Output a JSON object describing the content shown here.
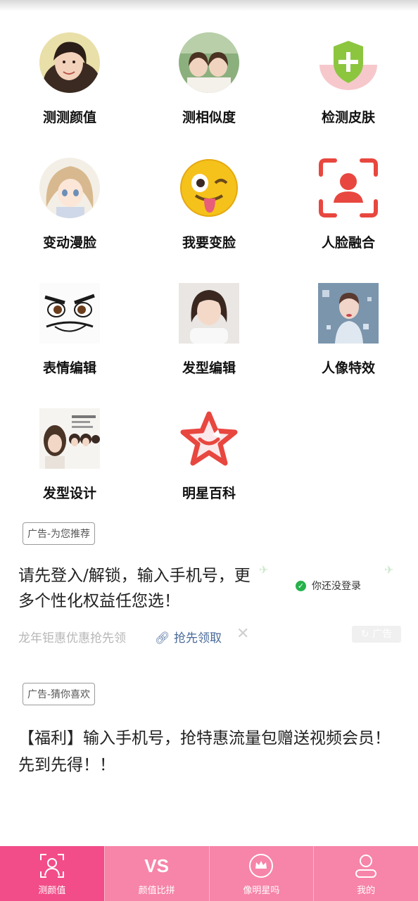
{
  "features": [
    {
      "label": "测测颜值",
      "icon": "woman-portrait-icon"
    },
    {
      "label": "测相似度",
      "icon": "two-girls-photo-icon"
    },
    {
      "label": "检测皮肤",
      "icon": "shield-plus-icon"
    },
    {
      "label": "变动漫脸",
      "icon": "anime-girl-icon"
    },
    {
      "label": "我要变脸",
      "icon": "winking-tongue-emoji-icon"
    },
    {
      "label": "人脸融合",
      "icon": "face-scan-icon"
    },
    {
      "label": "表情编辑",
      "icon": "cartoon-eyes-face-icon"
    },
    {
      "label": "发型编辑",
      "icon": "short-hair-girl-icon"
    },
    {
      "label": "人像特效",
      "icon": "dispersion-portrait-icon"
    },
    {
      "label": "发型设计",
      "icon": "hairstyle-catalog-icon"
    },
    {
      "label": "明星百科",
      "icon": "smiling-star-icon"
    }
  ],
  "ad1": {
    "tag": "广告-为您推荐",
    "text": "请先登入/解锁，输入手机号，更多个性化权益任您选！",
    "login_status": "你还没登录",
    "promo": "龙年钜惠优惠抢先领",
    "grab_label": "抢先领取",
    "badge": "广告"
  },
  "ad2": {
    "tag": "广告-猜你喜欢",
    "text": "【福利】输入手机号，抢特惠流量包赠送视频会员！先到先得！！"
  },
  "tabs": [
    {
      "label": "测颜值",
      "icon": "face-scan-person-icon",
      "active": true
    },
    {
      "label": "颜值比拼",
      "icon": "vs-icon",
      "icon_text": "VS"
    },
    {
      "label": "像明星吗",
      "icon": "crown-circle-icon"
    },
    {
      "label": "我的",
      "icon": "user-icon"
    }
  ],
  "colors": {
    "accent": "#f24d88",
    "tab_bg": "#f784a9",
    "red_icon": "#e8473f",
    "green": "#8cc63f"
  }
}
